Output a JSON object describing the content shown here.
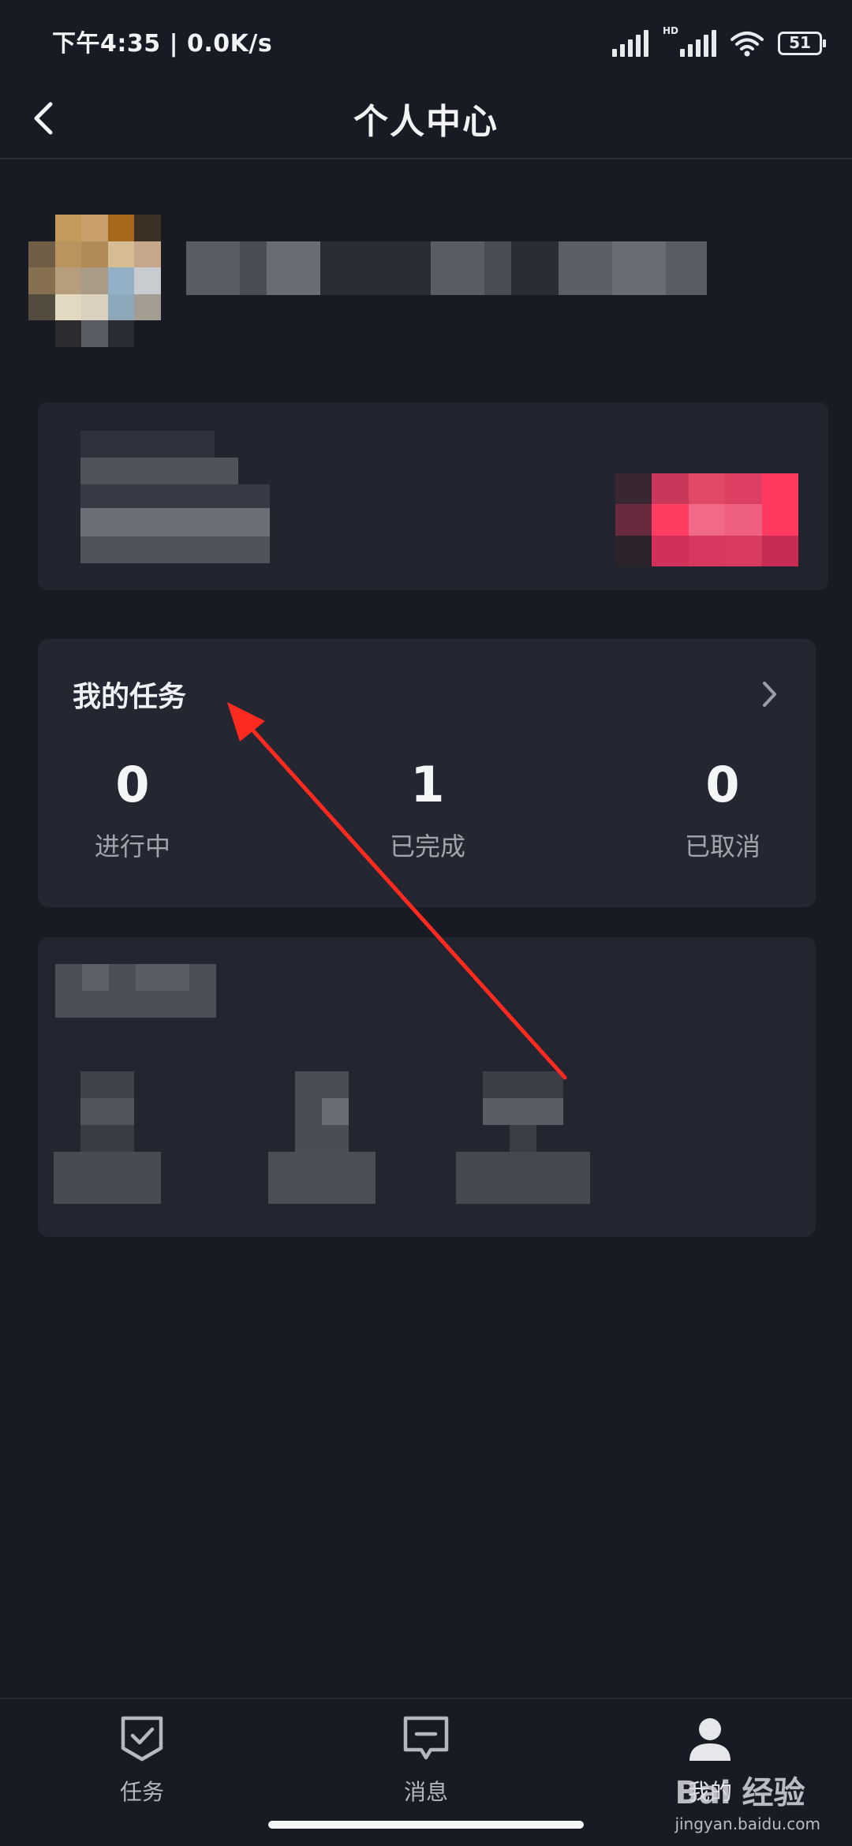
{
  "status_bar": {
    "time": "下午4:35 | 0.0K/s",
    "network_badge": "HD",
    "battery": "51"
  },
  "header": {
    "title": "个人中心"
  },
  "tasks": {
    "title": "我的任务",
    "stats": [
      {
        "value": "0",
        "label": "进行中"
      },
      {
        "value": "1",
        "label": "已完成"
      },
      {
        "value": "0",
        "label": "已取消"
      }
    ]
  },
  "bottom_nav": {
    "items": [
      {
        "label": "任务",
        "icon": "task-check-icon"
      },
      {
        "label": "消息",
        "icon": "message-icon"
      },
      {
        "label": "我的",
        "icon": "user-icon"
      }
    ]
  },
  "watermark": {
    "text": "Bai 经验",
    "sub": "jingyan.baidu.com"
  },
  "colors": {
    "background": "#181b24",
    "card": "#242731",
    "accent_pink": "#ff3a60",
    "annotation_red": "#ff2a1f"
  }
}
